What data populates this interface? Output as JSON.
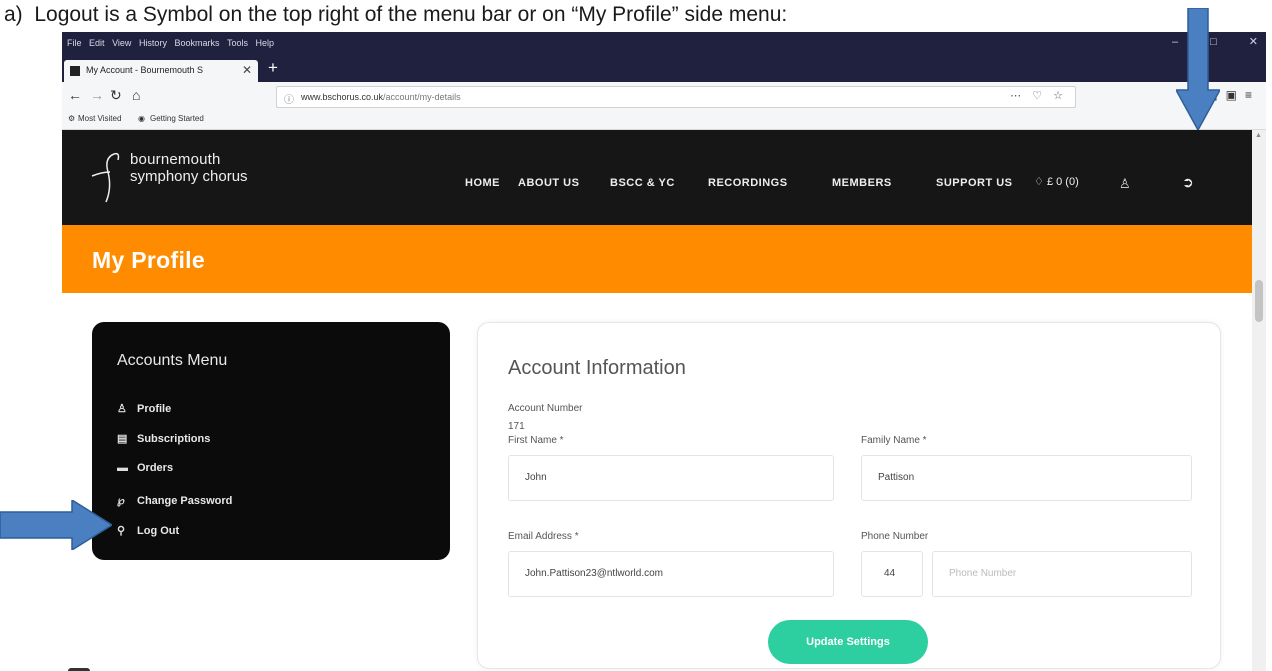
{
  "caption": "a)  Logout is a Symbol on the top right of the menu bar or on “My Profile” side menu:",
  "browser": {
    "menu": [
      "File",
      "Edit",
      "View",
      "History",
      "Bookmarks",
      "Tools",
      "Help"
    ],
    "tab_title": "My Account - Bournemouth S",
    "url_domain": "www.bschorus.co.uk",
    "url_path": "/account/my-details",
    "bookmarks": [
      "Most Visited",
      "Getting Started"
    ],
    "page_actions": "⋯ ♡ ☆"
  },
  "site": {
    "logo_line1": "bournemouth",
    "logo_line2": "symphony chorus",
    "nav": [
      "HOME",
      "ABOUT US",
      "BSCC & YC",
      "RECORDINGS",
      "MEMBERS",
      "SUPPORT US"
    ],
    "cart": "£ 0 (0)",
    "page_title": "My Profile"
  },
  "side_menu": {
    "title": "Accounts Menu",
    "items": [
      {
        "label": "Profile",
        "icon": "user-icon"
      },
      {
        "label": "Subscriptions",
        "icon": "list-icon"
      },
      {
        "label": "Orders",
        "icon": "card-icon"
      },
      {
        "label": "Change Password",
        "icon": "key-icon"
      },
      {
        "label": "Log Out",
        "icon": "lock-icon"
      }
    ]
  },
  "account": {
    "title": "Account Information",
    "account_number_label": "Account Number",
    "account_number": "171",
    "first_name_label": "First Name *",
    "first_name": "John",
    "family_name_label": "Family Name *",
    "family_name": "Pattison",
    "email_label": "Email Address *",
    "email": "John.Pattison23@ntlworld.com",
    "phone_label": "Phone Number",
    "phone_code": "44",
    "phone_placeholder": "Phone Number",
    "button": "Update Settings"
  },
  "colors": {
    "header": "#161616",
    "banner": "#ff8c00",
    "button": "#2dcfa0",
    "arrow": "#4a7fc1"
  }
}
